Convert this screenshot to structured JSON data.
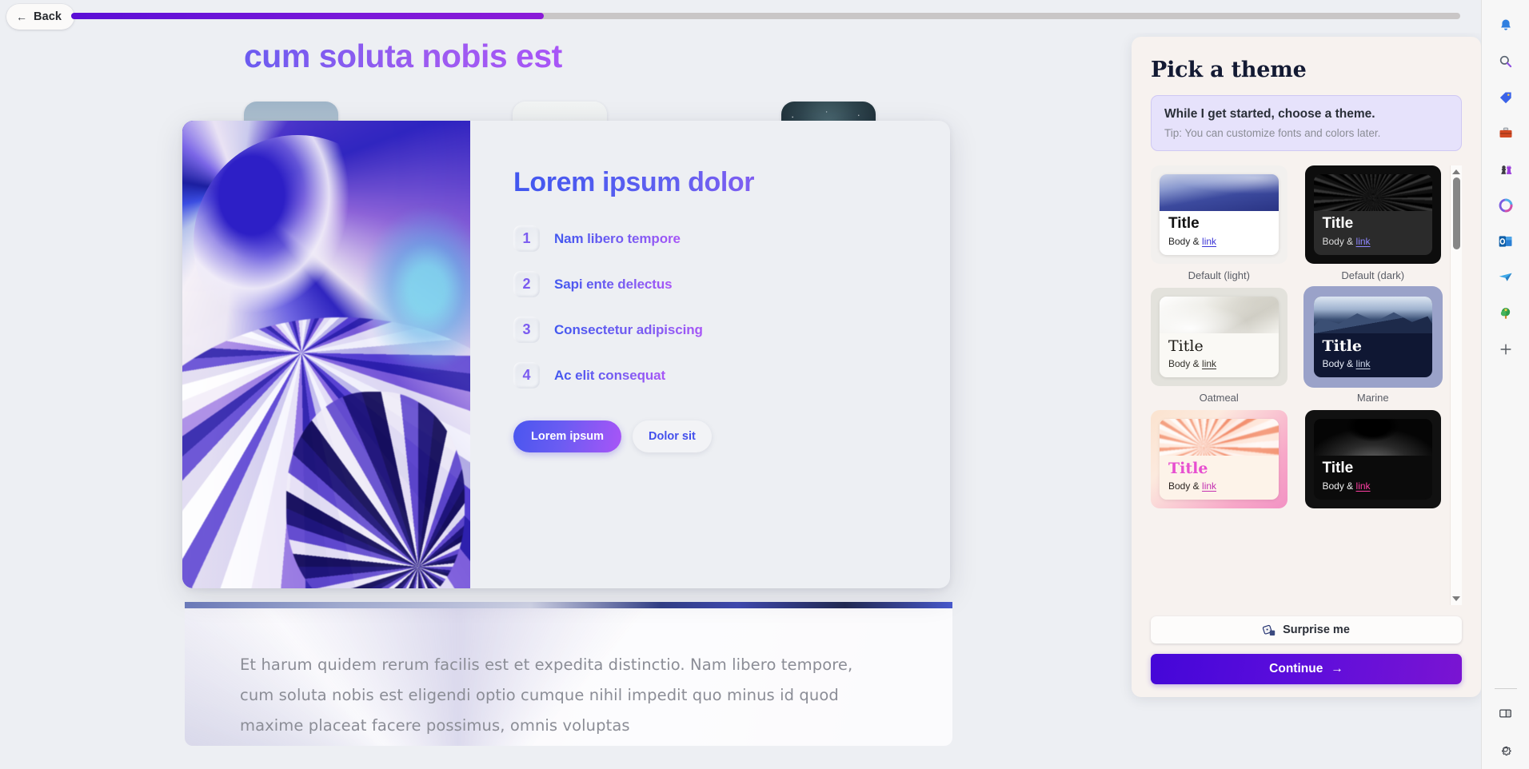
{
  "topbar": {
    "back_label": "Back",
    "back_arrow": "←",
    "progress_percent": 34
  },
  "deck": {
    "headline": "cum soluta nobis est",
    "paragraph": "Et harum quidem rerum facilis est et expedita distinctio. Nam libero tempore, cum soluta nobis est eligendi optio cumque nihil impedit quo minus id quod maxime placeat facere possimus, omnis voluptas",
    "thumbnails": [
      {
        "name": "mountain-peak-thumbnail"
      },
      {
        "name": "snow-dome-thumbnail"
      },
      {
        "name": "starry-night-thumbnail"
      }
    ]
  },
  "slide": {
    "title": "Lorem ipsum dolor",
    "bullets": [
      {
        "num": "1",
        "text": "Nam libero tempore"
      },
      {
        "num": "2",
        "text": "Sapi ente delectus"
      },
      {
        "num": "3",
        "text": "Consectetur adipiscing"
      },
      {
        "num": "4",
        "text": "Ac elit consequat"
      }
    ],
    "primary_cta": "Lorem ipsum",
    "secondary_cta": "Dolor sit"
  },
  "theme_panel": {
    "title": "Pick a theme",
    "tip_main": "While I get started, choose a theme.",
    "tip_sub": "Tip: You can customize fonts and colors later.",
    "card_title": "Title",
    "card_body_prefix": "Body & ",
    "card_body_link": "link",
    "themes": [
      {
        "label": "Default (light)",
        "variant": "tc-light",
        "selected": false
      },
      {
        "label": "Default (dark)",
        "variant": "tc-dark",
        "selected": false
      },
      {
        "label": "Oatmeal",
        "variant": "tc-oat",
        "selected": false
      },
      {
        "label": "Marine",
        "variant": "tc-marine",
        "selected": true
      },
      {
        "label": "",
        "variant": "tc-blush",
        "selected": false
      },
      {
        "label": "",
        "variant": "tc-onyx",
        "selected": false
      }
    ],
    "surprise_label": "Surprise me",
    "surprise_icon": "dice-icon",
    "continue_label": "Continue",
    "continue_arrow": "→"
  },
  "rail": {
    "icons": [
      "bell-icon",
      "search-icon",
      "tag-icon",
      "briefcase-icon",
      "chess-icon",
      "loop-icon",
      "outlook-icon",
      "send-icon",
      "tree-icon",
      "plus-icon"
    ],
    "bottom_icons": [
      "split-panel-icon",
      "gear-icon"
    ]
  },
  "colors": {
    "accent_purple": "#5b0fd6",
    "gradient_start": "#4157ef",
    "gradient_end": "#a855f7",
    "panel_bg": "#f7f2ef",
    "canvas_bg": "#edeff3"
  }
}
